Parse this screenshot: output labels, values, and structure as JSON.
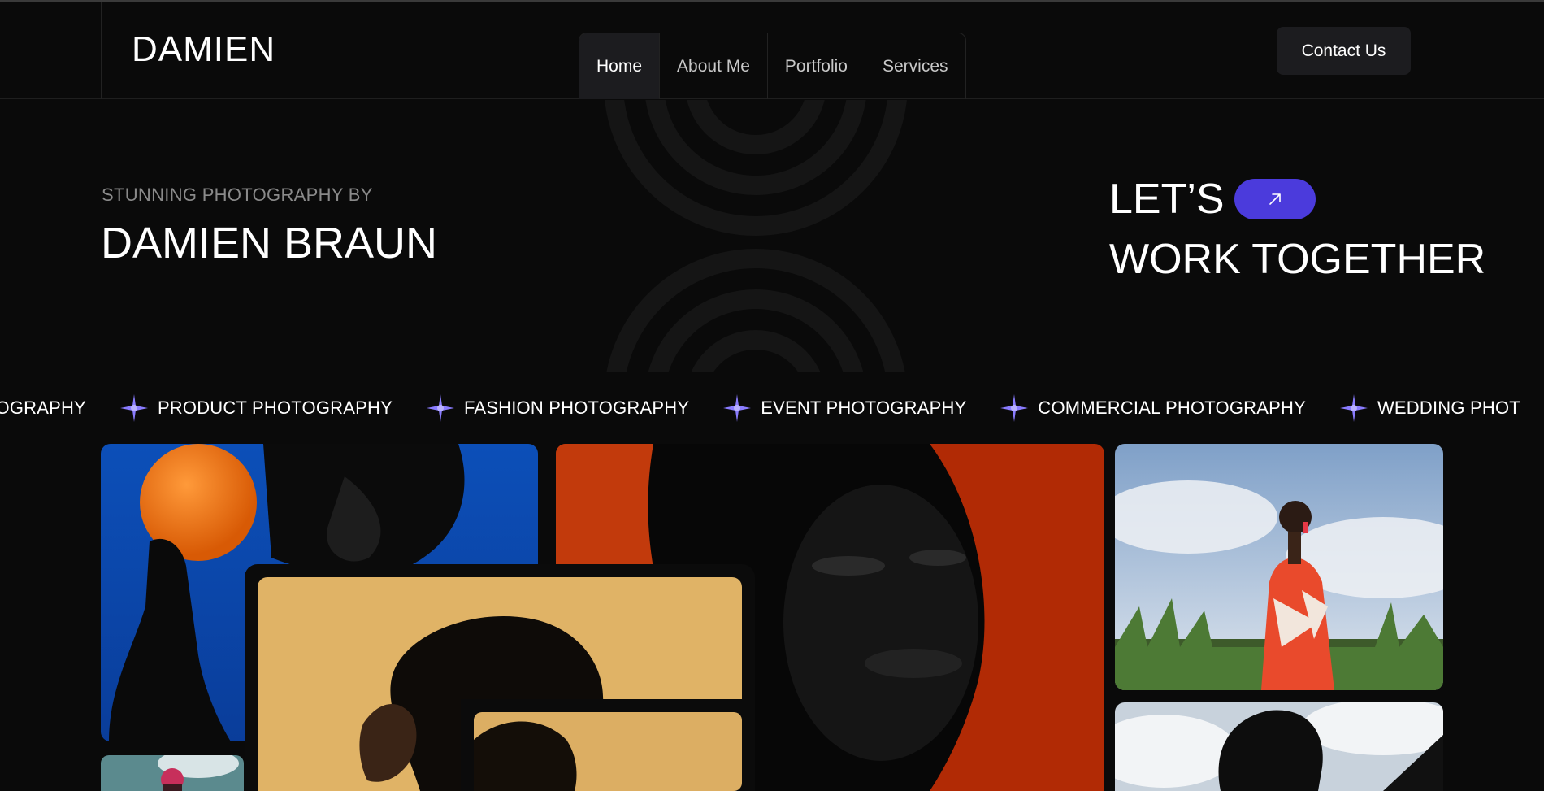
{
  "brand": {
    "logo": "DAMIEN"
  },
  "nav": {
    "items": [
      {
        "label": "Home",
        "active": true
      },
      {
        "label": "About Me"
      },
      {
        "label": "Portfolio"
      },
      {
        "label": "Services"
      }
    ]
  },
  "header": {
    "contact_label": "Contact Us"
  },
  "hero": {
    "eyebrow": "STUNNING PHOTOGRAPHY BY",
    "name": "DAMIEN BRAUN",
    "cta_line1": "LET’S",
    "cta_line2": "WORK TOGETHER",
    "cta_icon": "arrow-up-right-icon",
    "accent": "#4b3bdc"
  },
  "marquee": {
    "items": [
      "PHOTOGRAPHY",
      "PRODUCT PHOTOGRAPHY",
      "FASHION PHOTOGRAPHY",
      "EVENT PHOTOGRAPHY",
      "COMMERCIAL PHOTOGRAPHY",
      "WEDDING PHOTOGRAPHY"
    ],
    "star_color": "#8a7cff"
  },
  "gallery": {
    "photos": [
      {
        "name": "photo-orange"
      },
      {
        "name": "photo-red-portrait"
      },
      {
        "name": "photo-field-fashion"
      },
      {
        "name": "photo-profile-gold"
      },
      {
        "name": "photo-sky-portrait"
      },
      {
        "name": "photo-small-bottom"
      }
    ]
  }
}
